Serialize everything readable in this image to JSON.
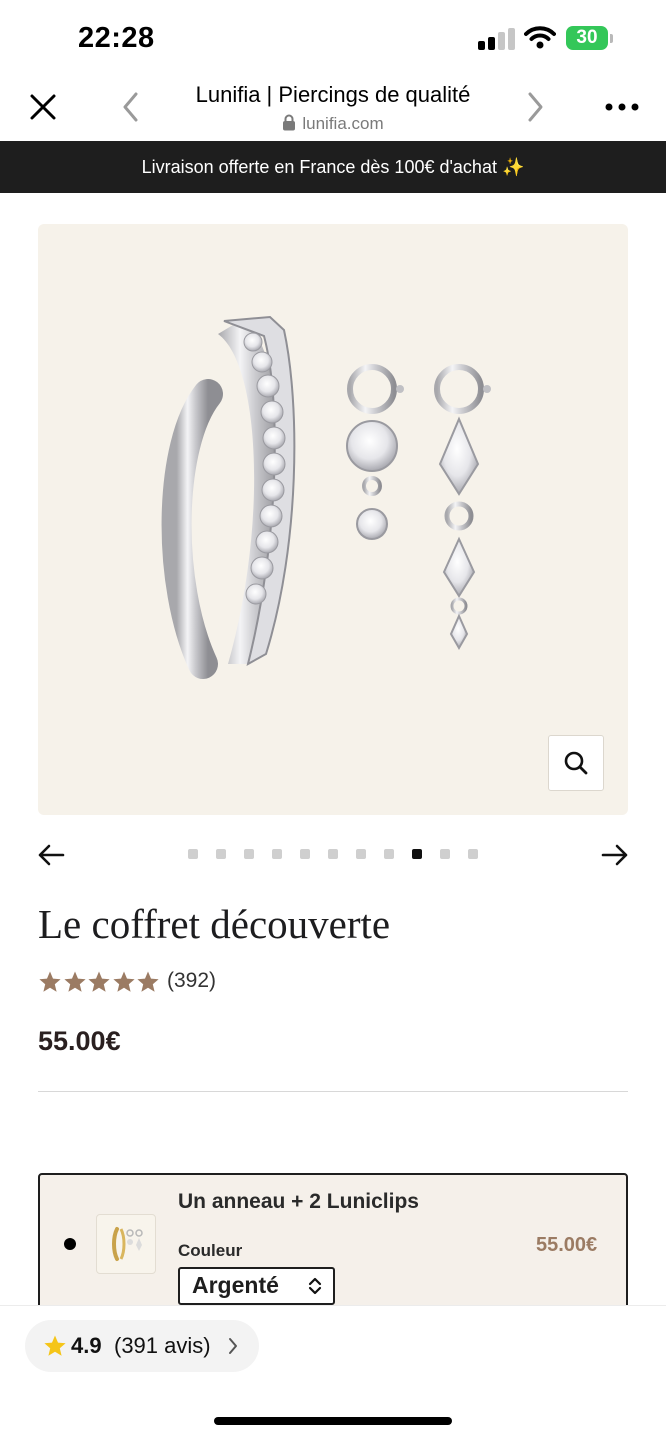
{
  "status_bar": {
    "time": "22:28",
    "battery": "30"
  },
  "browser": {
    "title": "Lunifia | Piercings de qualité",
    "url": "lunifia.com"
  },
  "banner": {
    "text": "Livraison offerte en France dès 100€ d'achat ✨"
  },
  "gallery": {
    "slide_count": 11,
    "active_index": 8
  },
  "product": {
    "title": "Le coffret découverte",
    "rating": 5,
    "review_count": "(392)",
    "price": "55.00€"
  },
  "bundle": {
    "name": "Un anneau + 2 Luniclips",
    "color_label": "Couleur",
    "color_value": "Argenté",
    "price": "55.00€"
  },
  "rating_pill": {
    "score": "4.9",
    "count": "(391 avis)"
  },
  "colors": {
    "accent_price": "#9b7b63",
    "star": "#9b7b63",
    "pill_star": "#f5c518",
    "banner_bg": "#1e1e1e",
    "hero_bg": "#f6f2ea"
  }
}
